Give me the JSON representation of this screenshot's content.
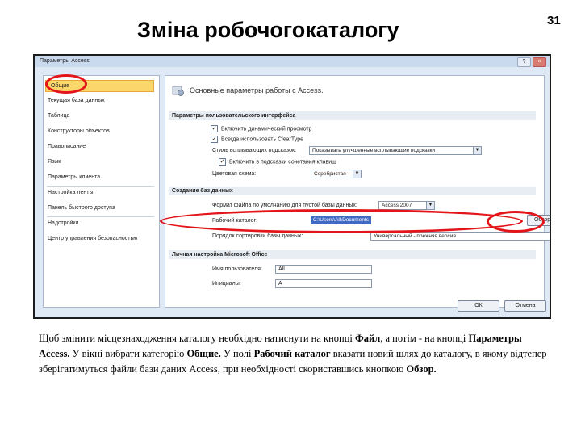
{
  "slide": {
    "title": "Зміна робочогокаталогу",
    "number": "31"
  },
  "dialog": {
    "title": "Параметры Access",
    "help_glyph": "?",
    "close_glyph": "×",
    "nav": [
      "Общие",
      "Текущая база данных",
      "Таблица",
      "Конструкторы объектов",
      "Правописание",
      "Язык",
      "Параметры клиента",
      "Настройка ленты",
      "Панель быстрого доступа",
      "Надстройки",
      "Центр управления безопасностью"
    ],
    "header_text": "Основные параметры работы с Access.",
    "ui_section": "Параметры пользовательского интерфейса",
    "cb_live_preview": "Включить динамический просмотр",
    "cb_cleartype": "Всегда использовать ClearType",
    "tooltip_label": "Стиль всплывающих подсказок:",
    "tooltip_value": "Показывать улучшенные всплывающие подсказки",
    "cb_shortcuts": "Включить в подсказки сочетания клавиш",
    "scheme_label": "Цветовая схема:",
    "scheme_value": "Серебристая",
    "create_section": "Создание баз данных",
    "format_label": "Формат файла по умолчанию для пустой базы данных:",
    "format_value": "Access 2007",
    "folder_label": "Рабочий каталог:",
    "folder_value": "C:\\Users\\All\\Documents",
    "browse_label": "Обзор...",
    "sort_label": "Порядок сортировки базы данных:",
    "sort_value": "Универсальный - прежняя версия",
    "personal_section": "Личная настройка Microsoft Office",
    "user_label": "Имя пользователя:",
    "user_value": "All",
    "initials_label": "Инициалы:",
    "initials_value": "A",
    "ok_label": "ОК",
    "cancel_label": "Отмена"
  },
  "caption": {
    "p1": "Щоб змінити місцезнаходження каталогу  необхідно натиснути на кнопці ",
    "b1": "Файл",
    "p2": ", а потім - на кнопці ",
    "b2": "Параметры Access.",
    "p3": " У вікні вибрати категорію ",
    "b3": "Общие.",
    "p4": " У полі ",
    "b4": "Рабочий каталог",
    "p5": " вказати новий шлях до каталогу, в якому відтепер зберігатимуться файли бази даних Access, при необхідності скориставшись кнопкою ",
    "b5": "Обзор."
  },
  "colors": {
    "highlight_circle": "#e3151a",
    "selected_nav": "#fbd66a",
    "path_selection": "#3f69c2"
  }
}
